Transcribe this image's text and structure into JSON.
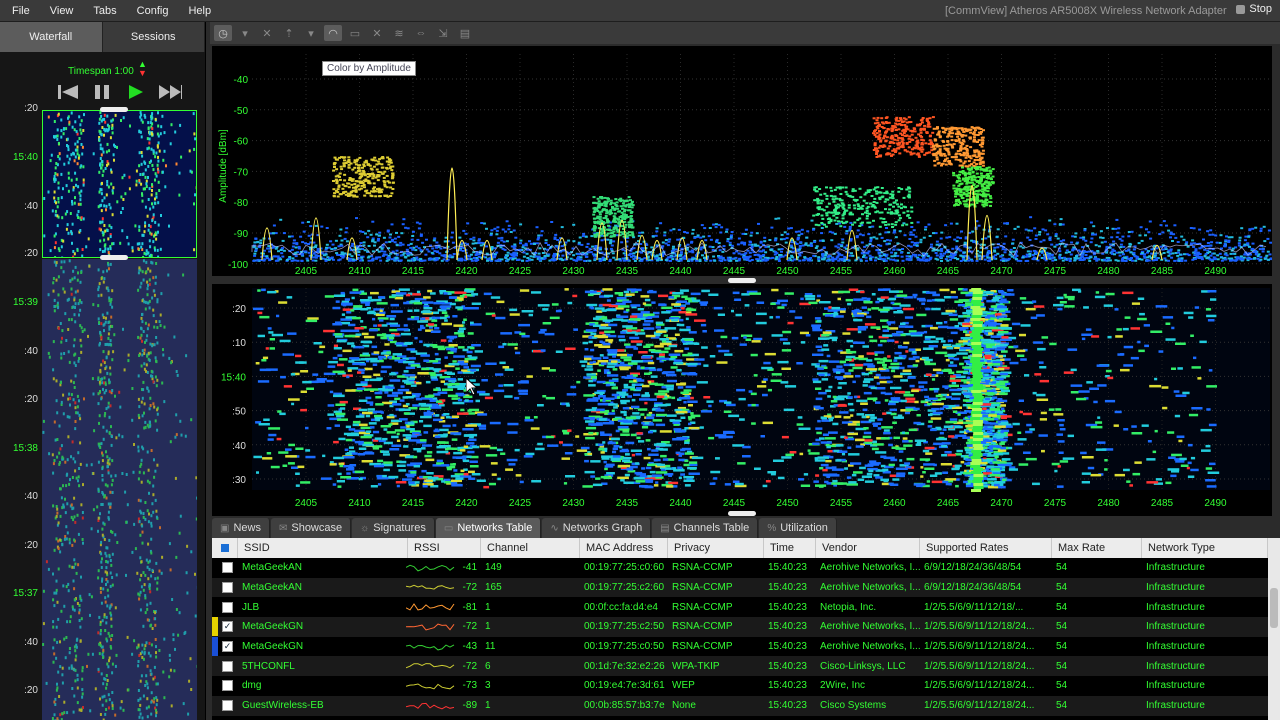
{
  "menu": [
    "File",
    "View",
    "Tabs",
    "Config",
    "Help"
  ],
  "window_title": "[CommView] Atheros AR5008X Wireless Network Adapter",
  "stop_label": "Stop",
  "left_tabs": [
    "Waterfall",
    "Sessions"
  ],
  "timespan_label": "Timespan 1:00",
  "left_time_labels": [
    {
      "text": ":20",
      "major": false
    },
    {
      "text": "15:40",
      "major": true
    },
    {
      "text": ":40",
      "major": false
    },
    {
      "text": ":20",
      "major": false
    },
    {
      "text": "15:39",
      "major": true
    },
    {
      "text": ":40",
      "major": false
    },
    {
      "text": ":20",
      "major": false
    },
    {
      "text": "15:38",
      "major": true
    },
    {
      "text": ":40",
      "major": false
    },
    {
      "text": ":20",
      "major": false
    },
    {
      "text": "15:37",
      "major": true
    },
    {
      "text": ":40",
      "major": false
    },
    {
      "text": ":20",
      "major": false
    }
  ],
  "tooltip": "Color by Amplitude",
  "amplitude_chart": {
    "ylabel": "Amplitude [dBm]",
    "y_ticks": [
      "-40",
      "-50",
      "-60",
      "-70",
      "-80",
      "-90",
      "-100"
    ],
    "x_ticks": [
      "2405",
      "2410",
      "2415",
      "2420",
      "2425",
      "2430",
      "2435",
      "2440",
      "2445",
      "2450",
      "2455",
      "2460",
      "2465",
      "2470",
      "2475",
      "2480",
      "2485",
      "2490"
    ]
  },
  "waterfall_chart": {
    "y_ticks": [
      ":20",
      ":10",
      "15:40",
      ":50",
      ":40",
      ":30"
    ],
    "x_ticks": [
      "2405",
      "2410",
      "2415",
      "2420",
      "2425",
      "2430",
      "2435",
      "2440",
      "2445",
      "2450",
      "2455",
      "2460",
      "2465",
      "2470",
      "2475",
      "2480",
      "2485",
      "2490"
    ]
  },
  "bottom_tabs": [
    "News",
    "Showcase",
    "Signatures",
    "Networks Table",
    "Networks Graph",
    "Channels Table",
    "Utilization"
  ],
  "active_bottom_tab": "Networks Table",
  "table": {
    "columns": [
      "SSID",
      "RSSI",
      "Channel",
      "MAC Address",
      "Privacy",
      "Time",
      "Vendor",
      "Supported Rates",
      "Max Rate",
      "Network Type"
    ],
    "rows": [
      {
        "ssid": "MetaGeekAN",
        "rssi": "-41",
        "channel": "149",
        "mac": "00:19:77:25:c0:60",
        "privacy": "RSNA-CCMP",
        "time": "15:40:23",
        "vendor": "Aerohive Networks, I...",
        "rates": "6/9/12/18/24/36/48/54",
        "max_rate": "54",
        "type": "Infrastructure",
        "checked": false,
        "color": "",
        "spark": "#33cc33"
      },
      {
        "ssid": "MetaGeekAN",
        "rssi": "-72",
        "channel": "165",
        "mac": "00:19:77:25:c2:60",
        "privacy": "RSNA-CCMP",
        "time": "15:40:23",
        "vendor": "Aerohive Networks, I...",
        "rates": "6/9/12/18/24/36/48/54",
        "max_rate": "54",
        "type": "Infrastructure",
        "checked": false,
        "color": "",
        "spark": "#cccc33"
      },
      {
        "ssid": "JLB",
        "rssi": "-81",
        "channel": "1",
        "mac": "00:0f:cc:fa:d4:e4",
        "privacy": "RSNA-CCMP",
        "time": "15:40:23",
        "vendor": "Netopia, Inc.",
        "rates": "1/2/5.5/6/9/11/12/18/...",
        "max_rate": "54",
        "type": "Infrastructure",
        "checked": false,
        "color": "",
        "spark": "#ff9933"
      },
      {
        "ssid": "MetaGeekGN",
        "rssi": "-72",
        "channel": "1",
        "mac": "00:19:77:25:c2:50",
        "privacy": "RSNA-CCMP",
        "time": "15:40:23",
        "vendor": "Aerohive Networks, I...",
        "rates": "1/2/5.5/6/9/11/12/18/24...",
        "max_rate": "54",
        "type": "Infrastructure",
        "checked": true,
        "color": "#e6d200",
        "spark": "#ff6633"
      },
      {
        "ssid": "MetaGeekGN",
        "rssi": "-43",
        "channel": "11",
        "mac": "00:19:77:25:c0:50",
        "privacy": "RSNA-CCMP",
        "time": "15:40:23",
        "vendor": "Aerohive Networks, I...",
        "rates": "1/2/5.5/6/9/11/12/18/24...",
        "max_rate": "54",
        "type": "Infrastructure",
        "checked": true,
        "color": "#1a4fd6",
        "spark": "#33cc33"
      },
      {
        "ssid": "5THCONFL",
        "rssi": "-72",
        "channel": "6",
        "mac": "00:1d:7e:32:e2:26",
        "privacy": "WPA-TKIP",
        "time": "15:40:23",
        "vendor": "Cisco-Linksys, LLC",
        "rates": "1/2/5.5/6/9/11/12/18/24...",
        "max_rate": "54",
        "type": "Infrastructure",
        "checked": false,
        "color": "",
        "spark": "#cccc33"
      },
      {
        "ssid": "dmg",
        "rssi": "-73",
        "channel": "3",
        "mac": "00:19:e4:7e:3d:61",
        "privacy": "WEP",
        "time": "15:40:23",
        "vendor": "2Wire, Inc",
        "rates": "1/2/5.5/6/9/11/12/18/24...",
        "max_rate": "54",
        "type": "Infrastructure",
        "checked": false,
        "color": "",
        "spark": "#cccc33"
      },
      {
        "ssid": "GuestWireless-EB",
        "rssi": "-89",
        "channel": "1",
        "mac": "00:0b:85:57:b3:7e",
        "privacy": "None",
        "time": "15:40:23",
        "vendor": "Cisco Systems",
        "rates": "1/2/5.5/6/9/11/12/18/24...",
        "max_rate": "54",
        "type": "Infrastructure",
        "checked": false,
        "color": "",
        "spark": "#ff3333"
      }
    ]
  }
}
